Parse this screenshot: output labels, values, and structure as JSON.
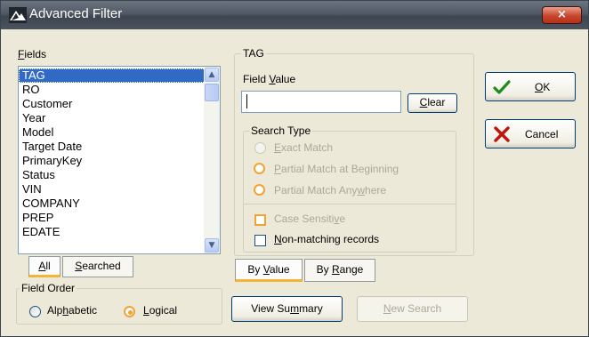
{
  "window": {
    "title": "Advanced Filter",
    "close_glyph": "×"
  },
  "fields": {
    "label_hotkey": "F",
    "label_rest": "ields",
    "items": [
      "TAG",
      "RO",
      "Customer",
      "Year",
      "Model",
      "Target Date",
      "PrimaryKey",
      "Status",
      "VIN",
      "COMPANY",
      "PREP",
      "EDATE"
    ],
    "selected": "TAG",
    "tabs": [
      {
        "hotkey": "A",
        "rest": "ll",
        "pre": ""
      },
      {
        "hotkey": "S",
        "rest": "earched",
        "pre": ""
      }
    ]
  },
  "field_order": {
    "caption": "Field Order",
    "alpha_pre": "Alp",
    "alpha_hotkey": "h",
    "alpha_post": "abetic",
    "logical_hotkey": "L",
    "logical_post": "ogical",
    "selected": "Logical"
  },
  "tag_group": {
    "caption": "TAG",
    "field_value_pre": "Field ",
    "field_value_hotkey": "V",
    "field_value_post": "alue",
    "field_value_input": "",
    "clear_hotkey": "C",
    "clear_post": "lear"
  },
  "search_type": {
    "caption": "Search Type",
    "exact_hotkey": "E",
    "exact_post": "xact Match",
    "partial_begin_hotkey": "P",
    "partial_begin_post": "artial Match at Beginning",
    "partial_any_pre": "Partial Match Any",
    "partial_any_hotkey": "w",
    "partial_any_post": "here",
    "case_pre": "Case Sensiti",
    "case_hotkey": "v",
    "case_post": "e",
    "non_hotkey": "N",
    "non_post": "on-matching records"
  },
  "value_tabs": {
    "by_value_pre": "By ",
    "by_value_hotkey": "V",
    "by_value_post": "alue",
    "by_range_pre": "By ",
    "by_range_hotkey": "R",
    "by_range_post": "ange"
  },
  "buttons": {
    "view_summary_pre": "View Su",
    "view_summary_hotkey": "m",
    "view_summary_post": "mary",
    "new_search_hotkey": "N",
    "new_search_post": "ew Search",
    "ok_hotkey": "O",
    "ok_post": "K",
    "cancel": "Cancel"
  },
  "colors": {
    "selection": "#316ac5",
    "accent_orange": "#f3a235",
    "ok_check": "#1f8a1f",
    "cancel_x": "#c0140c"
  },
  "icons": {
    "app": "app-logo-icon",
    "ok": "checkmark-icon",
    "cancel": "red-x-icon"
  }
}
